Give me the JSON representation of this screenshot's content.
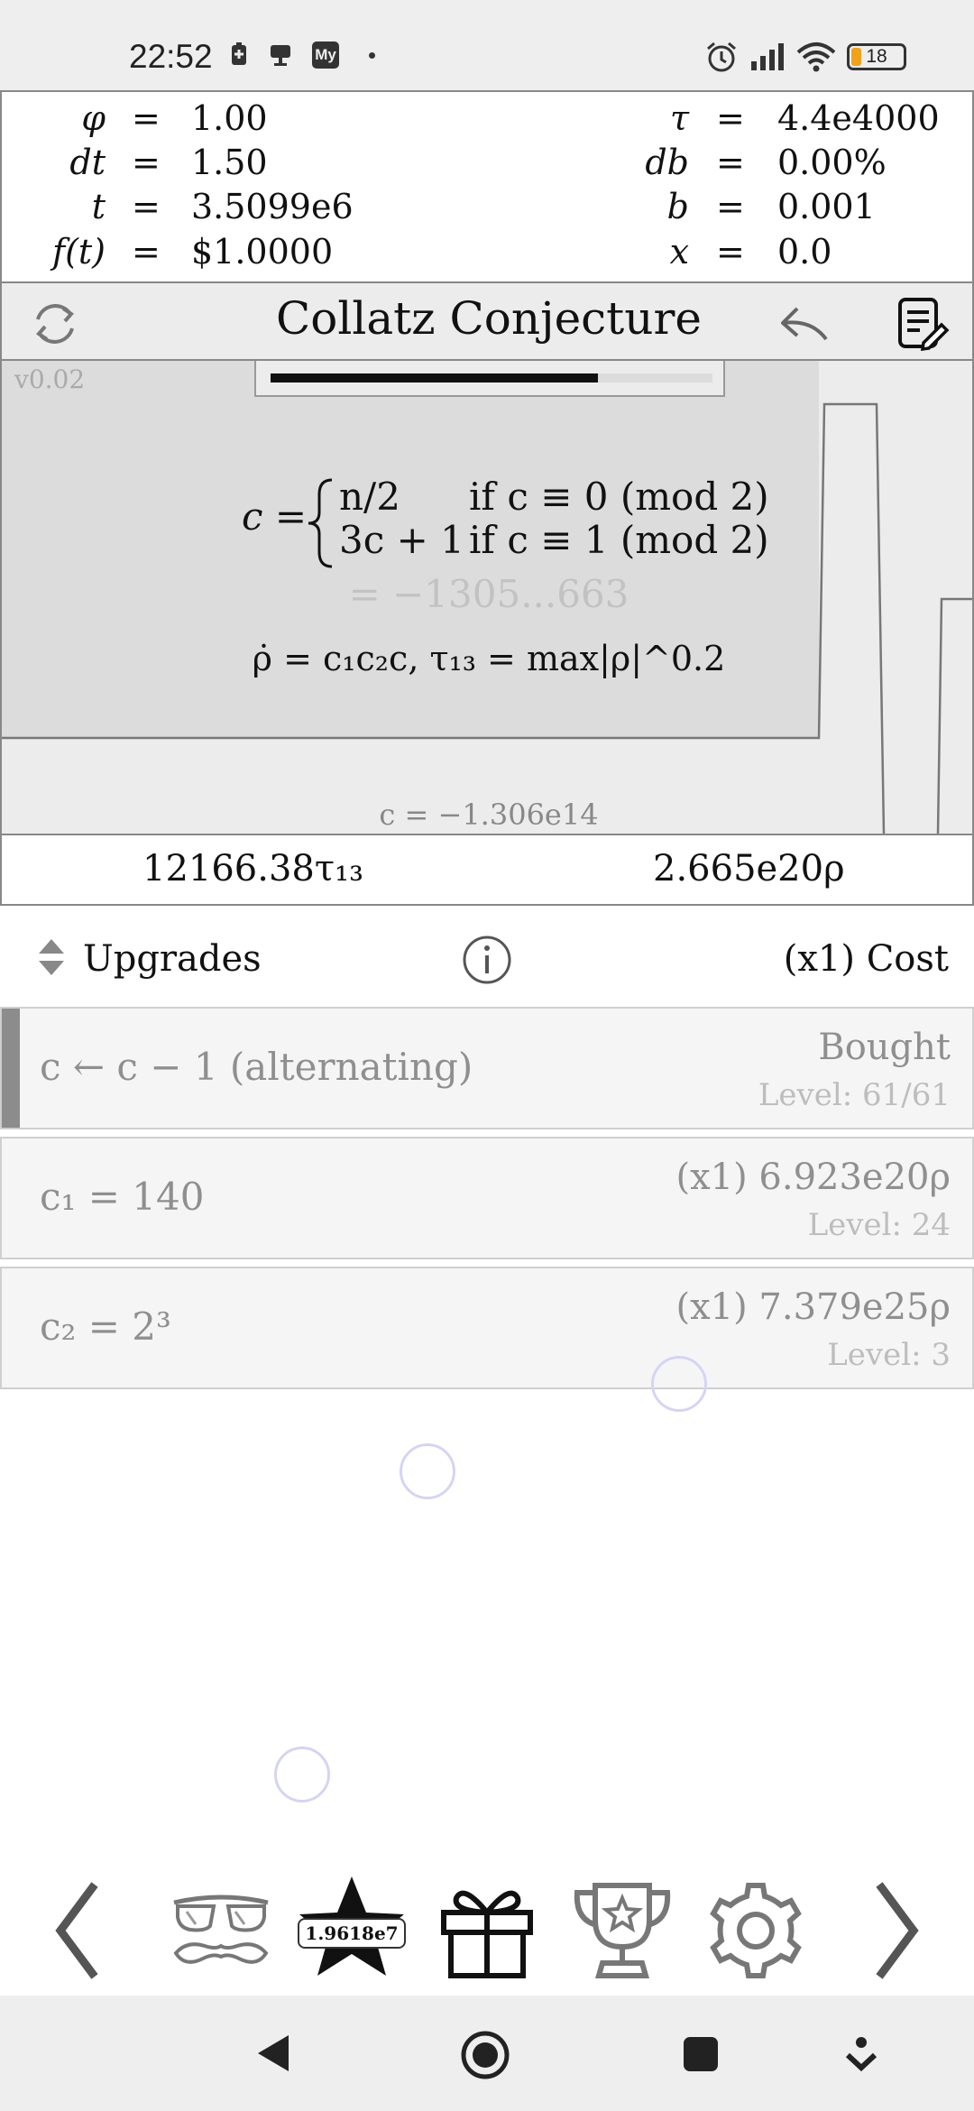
{
  "status_bar": {
    "time": "22:52",
    "icons_left": [
      "battery-saver-icon",
      "notification-icon",
      "my-app-icon",
      "dot-icon"
    ],
    "icons_right": [
      "alarm-icon",
      "signal-icon",
      "wifi-icon",
      "battery-icon"
    ],
    "battery_level": "18",
    "battery_fraction": 0.18,
    "my_badge": "My"
  },
  "variables": {
    "left": [
      {
        "name": "φ",
        "eq": "=",
        "value": "1.00"
      },
      {
        "name": "dt",
        "eq": "=",
        "value": "1.50"
      },
      {
        "name": "t",
        "eq": "=",
        "value": "3.5099e6"
      },
      {
        "name": "f(t)",
        "eq": "=",
        "value": "$1.0000"
      }
    ],
    "right": [
      {
        "name": "τ",
        "eq": "=",
        "value": "4.4e4000"
      },
      {
        "name": "db",
        "eq": "=",
        "value": "0.00%"
      },
      {
        "name": "b",
        "eq": "=",
        "value": "0.001"
      },
      {
        "name": "x",
        "eq": "=",
        "value": "0.0"
      }
    ]
  },
  "header": {
    "title": "Collatz Conjecture",
    "left_icon": "refresh-icon",
    "back_icon": "undo-icon",
    "notes_icon": "notes-edit-icon"
  },
  "theory": {
    "version": "v0.02",
    "progress": 0.74,
    "formula_lhs": "c =",
    "case1_expr": "n/2",
    "case1_cond": "if c ≡ 0 (mod 2)",
    "case2_expr": "3c + 1",
    "case2_cond": "if c ≡ 1 (mod 2)",
    "current_value": "= −1305...663",
    "rho_dot_formula": "ρ̇ = c₁c₂c,   τ₁₃ = max|ρ|^0.2",
    "c_value": "c = −1.306e14"
  },
  "currency": {
    "tau": "12166.38τ₁₃",
    "rho": "2.665e20ρ"
  },
  "upgrades": {
    "label": "Upgrades",
    "info_icon": "info-icon",
    "sort_icon": "sort-arrows-icon",
    "cost_label": "(x1) Cost",
    "items": [
      {
        "lhs": "c ← c − 1 (alternating)",
        "rhs_top": "Bought",
        "rhs_bottom": "Level: 61/61"
      },
      {
        "lhs": "c₁ = 140",
        "rhs_top": "(x1) 6.923e20ρ",
        "rhs_bottom": "Level: 24"
      },
      {
        "lhs": "c₂ = 2³",
        "rhs_top": "(x1) 7.379e25ρ",
        "rhs_bottom": "Level: 3"
      }
    ]
  },
  "bottom_nav": {
    "items": [
      "chevron-left-icon",
      "disguise-glasses-icon",
      "star-icon",
      "gift-icon",
      "trophy-icon",
      "gear-icon",
      "chevron-right-icon"
    ],
    "star_badge": "1.9618e7"
  },
  "system_nav": {
    "items": [
      "back-icon",
      "home-icon",
      "recents-icon",
      "keyboard-down-icon"
    ]
  }
}
